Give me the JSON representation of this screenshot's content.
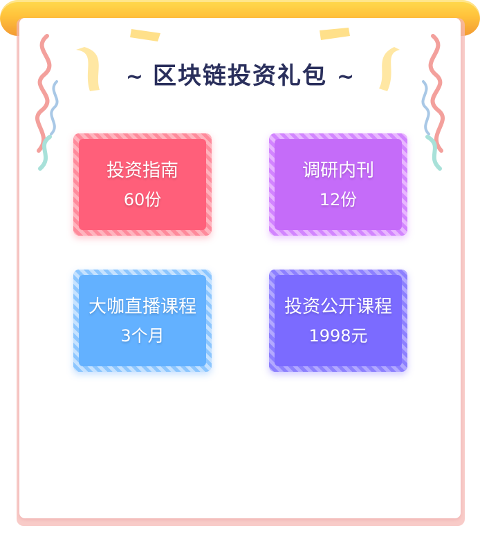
{
  "title": "区块链投资礼包",
  "title_tilde": "~",
  "gifts": [
    {
      "line1": "投资指南",
      "line2": "60份"
    },
    {
      "line1": "调研内刊",
      "line2": "12份"
    },
    {
      "line1": "大咖直播课程",
      "line2": "3个月"
    },
    {
      "line1": "投资公开课程",
      "line2": "1998元"
    }
  ],
  "colors": {
    "red": "#ff5f7a",
    "purple": "#c56cf9",
    "blue": "#63b1ff",
    "indigo": "#7b6bff",
    "title": "#2a2f5c",
    "bar": "#ffc23b"
  },
  "icons": [
    "ribbon-confetti-icon",
    "yellow-streamer-icon"
  ]
}
